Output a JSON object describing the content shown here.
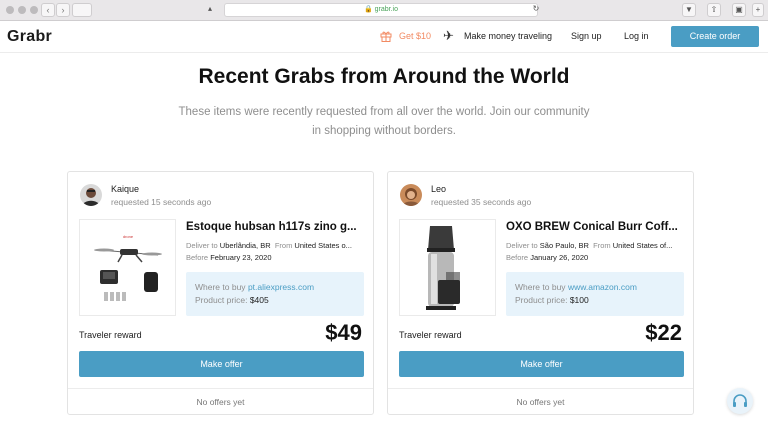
{
  "browser": {
    "url": "grabr.io"
  },
  "header": {
    "logo": "Grabr",
    "get10": "Get $10",
    "make_money": "Make money traveling",
    "signup": "Sign up",
    "login": "Log in",
    "cta": "Create order",
    "accent_color": "#4a9dc4",
    "promo_color": "#f28a62"
  },
  "hero": {
    "title": "Recent Grabs from Around the World",
    "subtitle": "These items were recently requested from all over the world. Join our community in shopping without borders."
  },
  "cards": [
    {
      "user": "Kaique",
      "time": "requested 15 seconds ago",
      "title": "Estoque hubsan h117s zino g...",
      "deliver_label": "Deliver to",
      "deliver_to": "Uberlândia, BR",
      "from_label": "From",
      "from": "United States o...",
      "before_label": "Before",
      "before": "February 23, 2020",
      "where_label": "Where to buy",
      "where": "pt.aliexpress.com",
      "price_label": "Product price:",
      "price": "$405",
      "reward_label": "Traveler reward",
      "reward": "$49",
      "offer_button": "Make offer",
      "offers": "No offers yet",
      "product_icon": "drone-kit-image"
    },
    {
      "user": "Leo",
      "time": "requested 35 seconds ago",
      "title": "OXO BREW Conical Burr Coff...",
      "deliver_label": "Deliver to",
      "deliver_to": "São Paulo, BR",
      "from_label": "From",
      "from": "United States of...",
      "before_label": "Before",
      "before": "January 26, 2020",
      "where_label": "Where to buy",
      "where": "www.amazon.com",
      "price_label": "Product price:",
      "price": "$100",
      "reward_label": "Traveler reward",
      "reward": "$22",
      "offer_button": "Make offer",
      "offers": "No offers yet",
      "product_icon": "coffee-grinder-image"
    }
  ]
}
